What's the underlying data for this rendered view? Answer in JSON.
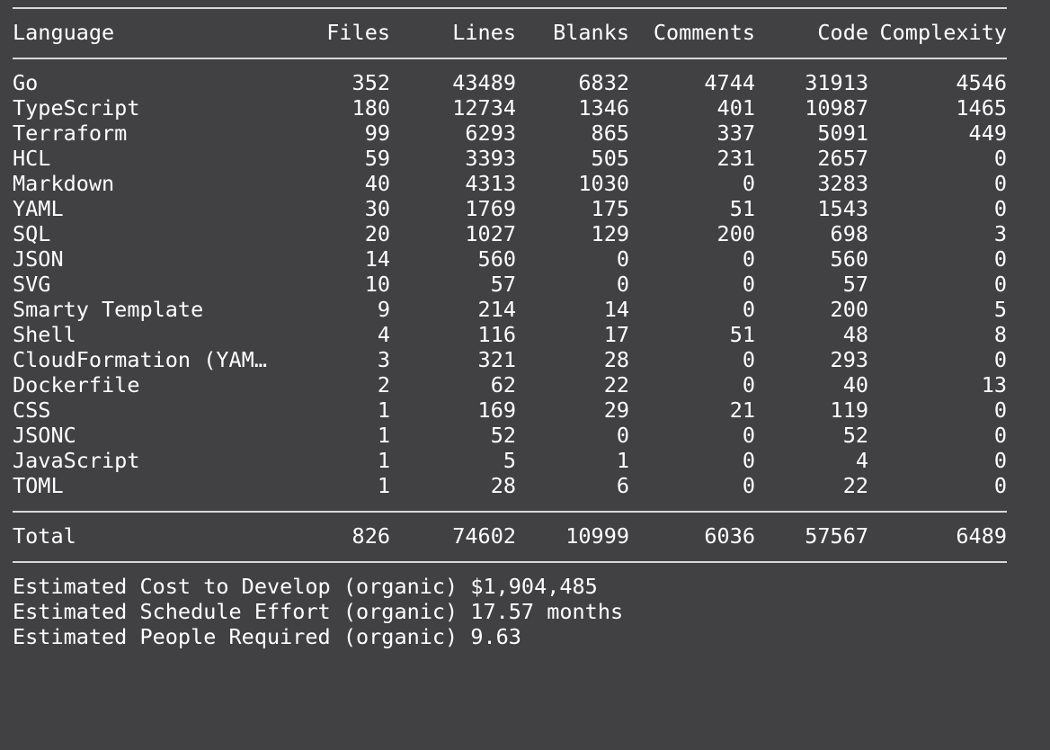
{
  "header": {
    "language": "Language",
    "files": "Files",
    "lines": "Lines",
    "blanks": "Blanks",
    "comments": "Comments",
    "code": "Code",
    "complexity": "Complexity"
  },
  "rows": [
    {
      "language": "Go",
      "files": "352",
      "lines": "43489",
      "blanks": "6832",
      "comments": "4744",
      "code": "31913",
      "complexity": "4546"
    },
    {
      "language": "TypeScript",
      "files": "180",
      "lines": "12734",
      "blanks": "1346",
      "comments": "401",
      "code": "10987",
      "complexity": "1465"
    },
    {
      "language": "Terraform",
      "files": "99",
      "lines": "6293",
      "blanks": "865",
      "comments": "337",
      "code": "5091",
      "complexity": "449"
    },
    {
      "language": "HCL",
      "files": "59",
      "lines": "3393",
      "blanks": "505",
      "comments": "231",
      "code": "2657",
      "complexity": "0"
    },
    {
      "language": "Markdown",
      "files": "40",
      "lines": "4313",
      "blanks": "1030",
      "comments": "0",
      "code": "3283",
      "complexity": "0"
    },
    {
      "language": "YAML",
      "files": "30",
      "lines": "1769",
      "blanks": "175",
      "comments": "51",
      "code": "1543",
      "complexity": "0"
    },
    {
      "language": "SQL",
      "files": "20",
      "lines": "1027",
      "blanks": "129",
      "comments": "200",
      "code": "698",
      "complexity": "3"
    },
    {
      "language": "JSON",
      "files": "14",
      "lines": "560",
      "blanks": "0",
      "comments": "0",
      "code": "560",
      "complexity": "0"
    },
    {
      "language": "SVG",
      "files": "10",
      "lines": "57",
      "blanks": "0",
      "comments": "0",
      "code": "57",
      "complexity": "0"
    },
    {
      "language": "Smarty Template",
      "files": "9",
      "lines": "214",
      "blanks": "14",
      "comments": "0",
      "code": "200",
      "complexity": "5"
    },
    {
      "language": "Shell",
      "files": "4",
      "lines": "116",
      "blanks": "17",
      "comments": "51",
      "code": "48",
      "complexity": "8"
    },
    {
      "language": "CloudFormation (YAM…",
      "files": "3",
      "lines": "321",
      "blanks": "28",
      "comments": "0",
      "code": "293",
      "complexity": "0"
    },
    {
      "language": "Dockerfile",
      "files": "2",
      "lines": "62",
      "blanks": "22",
      "comments": "0",
      "code": "40",
      "complexity": "13"
    },
    {
      "language": "CSS",
      "files": "1",
      "lines": "169",
      "blanks": "29",
      "comments": "21",
      "code": "119",
      "complexity": "0"
    },
    {
      "language": "JSONC",
      "files": "1",
      "lines": "52",
      "blanks": "0",
      "comments": "0",
      "code": "52",
      "complexity": "0"
    },
    {
      "language": "JavaScript",
      "files": "1",
      "lines": "5",
      "blanks": "1",
      "comments": "0",
      "code": "4",
      "complexity": "0"
    },
    {
      "language": "TOML",
      "files": "1",
      "lines": "28",
      "blanks": "6",
      "comments": "0",
      "code": "22",
      "complexity": "0"
    }
  ],
  "total": {
    "language": "Total",
    "files": "826",
    "lines": "74602",
    "blanks": "10999",
    "comments": "6036",
    "code": "57567",
    "complexity": "6489"
  },
  "estimates": [
    "Estimated Cost to Develop (organic) $1,904,485",
    "Estimated Schedule Effort (organic) 17.57 months",
    "Estimated People Required (organic) 9.63"
  ],
  "colors": {
    "background": "#414042",
    "text": "#ffffff",
    "rule": "#d8d8d8"
  }
}
